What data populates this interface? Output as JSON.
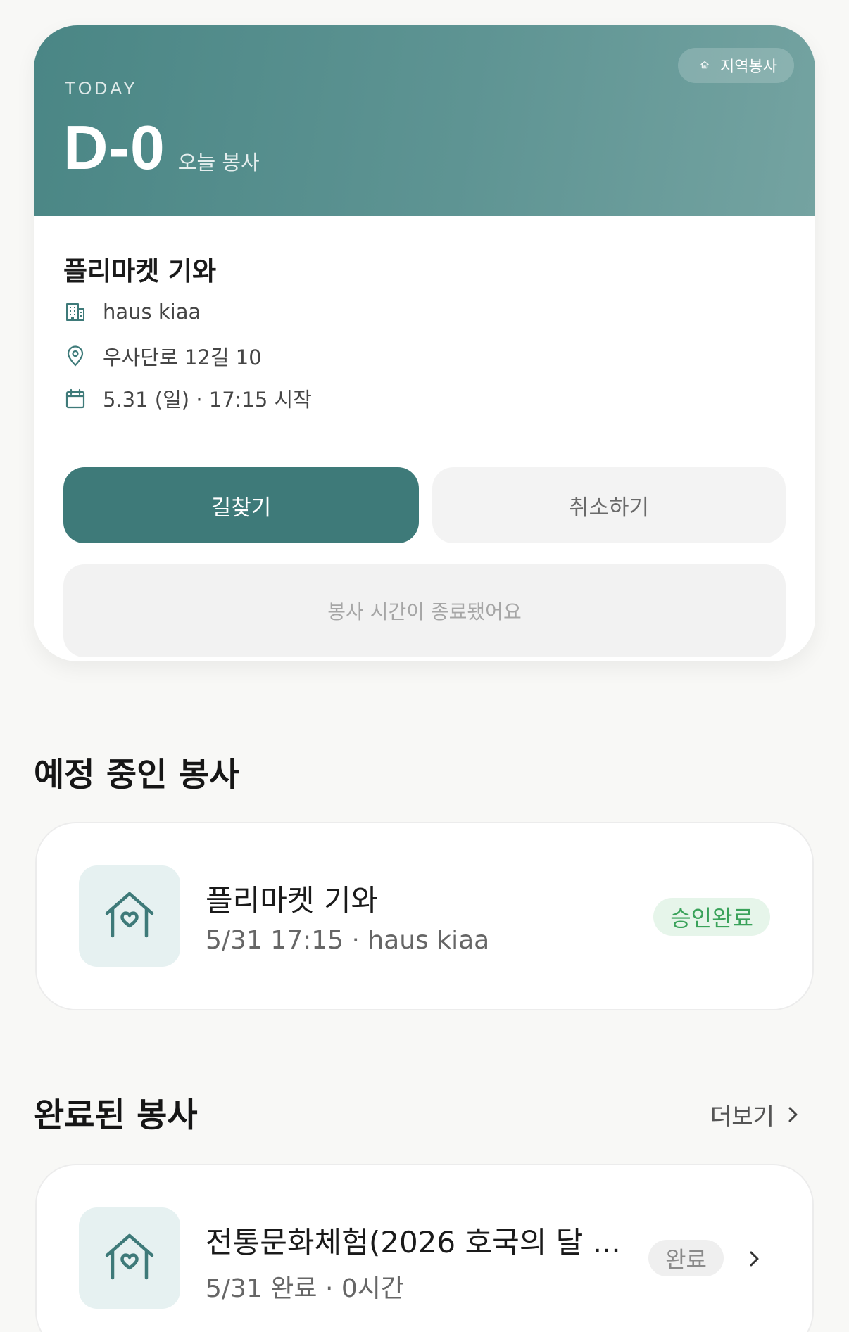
{
  "today": {
    "eyebrow": "TODAY",
    "dday": "D-0",
    "dday_sub": "오늘 봉사",
    "badge": {
      "icon": "house-icon",
      "label": "지역봉사"
    },
    "event": {
      "title": "플리마켓 기와",
      "org": {
        "icon": "building-icon",
        "text": "haus kiaa"
      },
      "address": {
        "icon": "location-pin-icon",
        "text": "우사단로 12길 10"
      },
      "datetime": {
        "icon": "calendar-icon",
        "text": "5.31 (일) · 17:15 시작"
      }
    },
    "buttons": {
      "directions": "길찾기",
      "cancel": "취소하기",
      "ended": "봉사 시간이 종료됐어요"
    }
  },
  "upcoming": {
    "title": "예정 중인 봉사",
    "items": [
      {
        "icon": "house-heart-icon",
        "title": "플리마켓 기와",
        "subtitle": "5/31 17:15 · haus kiaa",
        "status": "승인완료"
      }
    ]
  },
  "completed": {
    "title": "완료된 봉사",
    "more_label": "더보기",
    "items": [
      {
        "icon": "house-heart-icon",
        "title": "전통문화체험(2026 호국의 달 ...",
        "subtitle": "5/31 완료 · 0시간",
        "status": "완료"
      }
    ]
  },
  "colors": {
    "primary": "#3e7a79",
    "hero_start": "#4a8685",
    "hero_end": "#74a3a1",
    "approved_text": "#3aa25a",
    "approved_bg": "#e6f5ea"
  }
}
